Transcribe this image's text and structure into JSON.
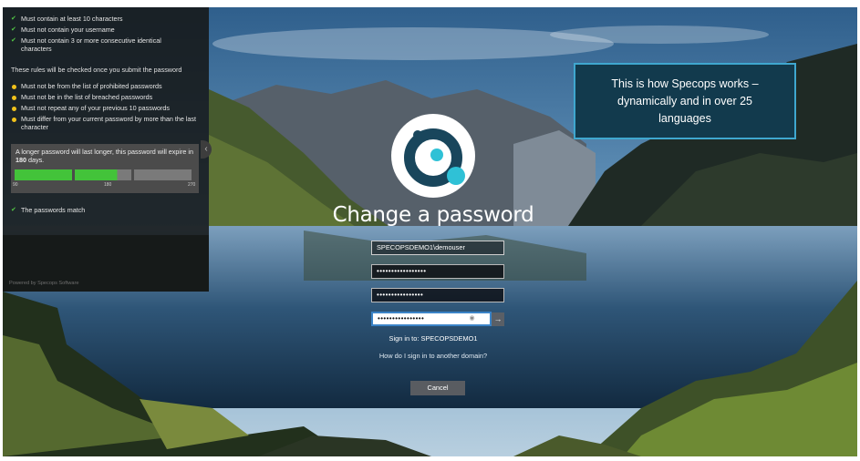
{
  "panel": {
    "rules_passed": [
      "Must contain at least 10 characters",
      "Must not contain your username",
      "Must not contain 3 or more consecutive identical characters"
    ],
    "section_label": "These rules will be checked once you submit the password",
    "rules_pending": [
      "Must not be from the list of prohibited passwords",
      "Must not be in the list of breached passwords",
      "Must not repeat any of your previous 10 passwords",
      "Must differ from your current password by more than the last character"
    ],
    "expiry": {
      "text_before": "A longer password will last longer, this password will expire in",
      "days": "180",
      "text_after": "days.",
      "ticks": [
        "90",
        "180",
        "270"
      ],
      "progress_days": 180,
      "max_days": 270
    },
    "match_text": "The passwords match",
    "powered_by": "Powered by Specops Software"
  },
  "callout": {
    "lines": [
      "This is how Specops works –",
      "dynamically and in over 25",
      "languages"
    ]
  },
  "form": {
    "title": "Change a password",
    "username": "SPECOPSDEMO1\\demouser",
    "old_password": "•••••••••••••••••",
    "new_password": "••••••••••••••••",
    "confirm_password": "••••••••••••••••",
    "sign_in_to": "Sign in to: SPECOPSDEMO1",
    "other_domain_link": "How do I sign in to another domain?",
    "cancel_label": "Cancel"
  },
  "colors": {
    "check": "#53c845",
    "pending": "#f1c21b",
    "bar_fill": "#43c33a",
    "callout_bg": "#123a4d",
    "callout_border": "#3fa7cf",
    "logo_ring": "#19465c",
    "logo_accent": "#2fc1d6"
  },
  "icons": [
    "check-icon",
    "pending-dot-icon",
    "collapse-chevron-icon",
    "specops-logo-icon",
    "eye-icon",
    "arrow-right-icon"
  ]
}
